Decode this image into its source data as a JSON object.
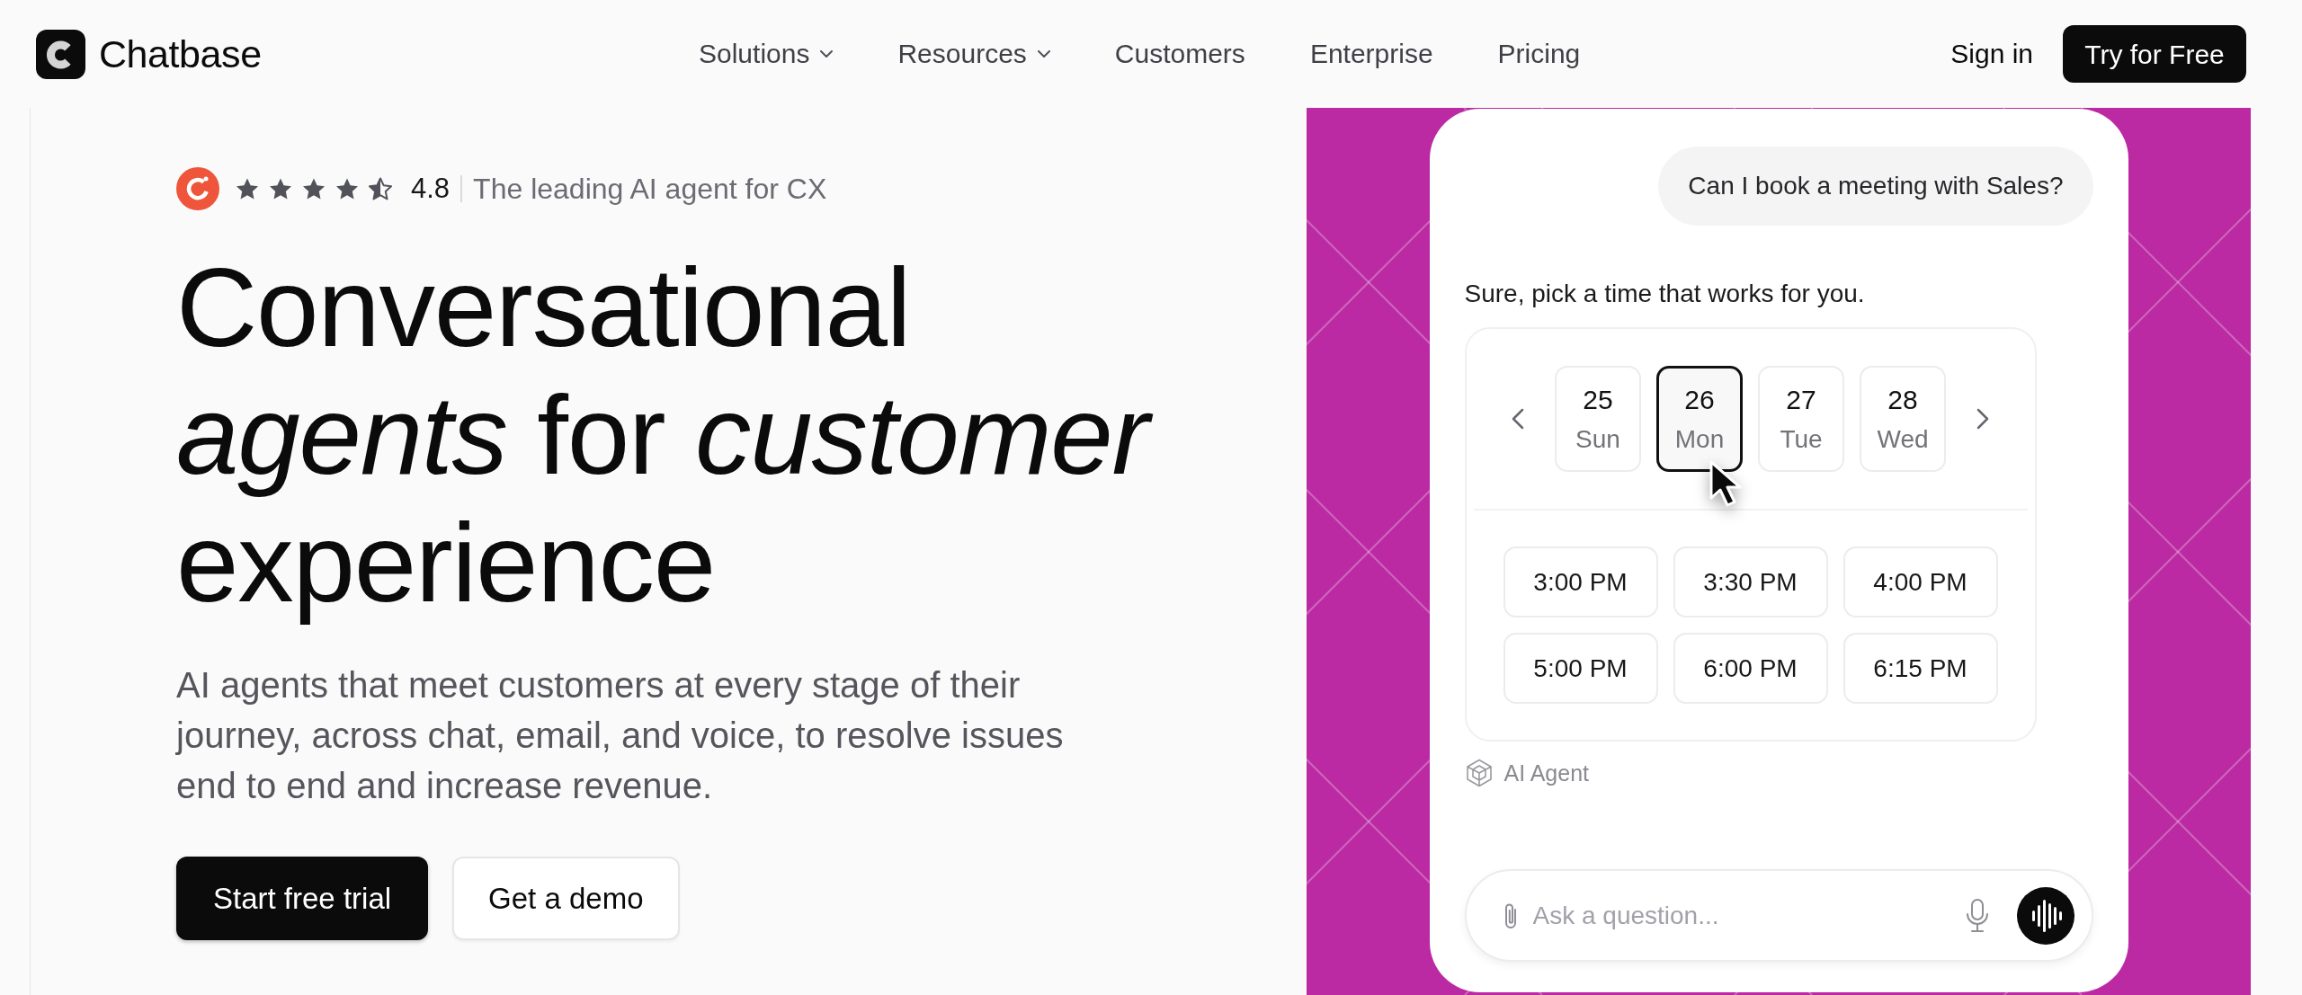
{
  "nav": {
    "brand": "Chatbase",
    "links": [
      {
        "label": "Solutions",
        "dropdown": true
      },
      {
        "label": "Resources",
        "dropdown": true
      },
      {
        "label": "Customers",
        "dropdown": false
      },
      {
        "label": "Enterprise",
        "dropdown": false
      },
      {
        "label": "Pricing",
        "dropdown": false
      }
    ],
    "sign_in": "Sign in",
    "cta": "Try for Free"
  },
  "hero": {
    "rating": {
      "stars": 4.5,
      "score": "4.8",
      "tagline": "The leading AI agent for CX"
    },
    "headline": "Conversational *agents* for *customer* experience",
    "description": "AI agents that meet customers at every stage of their journey, across chat, email, and voice, to resolve issues end to end and increase revenue.",
    "buttons": [
      {
        "label": "Start free trial",
        "kind": "primary"
      },
      {
        "label": "Get a demo",
        "kind": "secondary"
      }
    ]
  },
  "chat": {
    "messages": [
      {
        "kind": "user",
        "text": "Can I book a meeting with Sales?"
      },
      {
        "kind": "agent",
        "text": "Sure, pick a time that works for you."
      }
    ],
    "dates": [
      {
        "day": "25",
        "weekday": "Sun",
        "selected": false
      },
      {
        "day": "26",
        "weekday": "Mon",
        "selected": true
      },
      {
        "day": "27",
        "weekday": "Tue",
        "selected": false
      },
      {
        "day": "28",
        "weekday": "Wed",
        "selected": false
      }
    ],
    "times": [
      "3:00 PM",
      "3:30 PM",
      "4:00 PM",
      "5:00 PM",
      "6:00 PM",
      "6:15 PM"
    ],
    "sender": "AI Agent",
    "composer": {
      "placeholder": "Ask a question..."
    }
  }
}
